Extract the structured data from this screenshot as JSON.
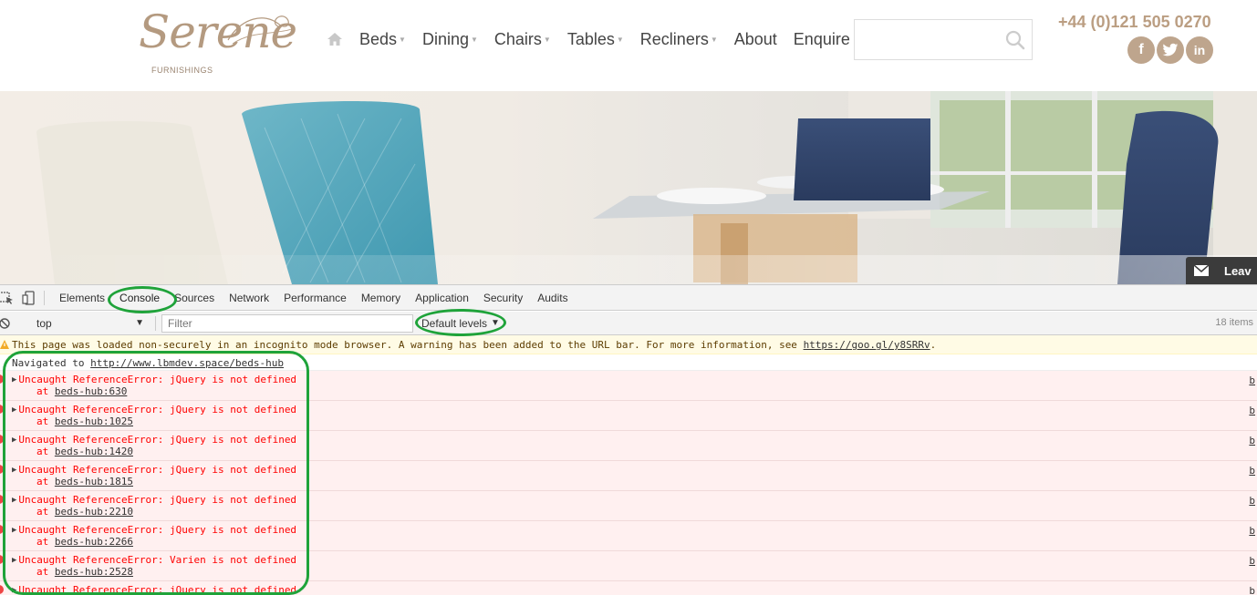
{
  "site": {
    "logo_text": "Serene",
    "logo_sub": "FURNISHINGS",
    "nav": [
      {
        "label": "Beds",
        "dropdown": true
      },
      {
        "label": "Dining",
        "dropdown": true
      },
      {
        "label": "Chairs",
        "dropdown": true
      },
      {
        "label": "Tables",
        "dropdown": true
      },
      {
        "label": "Recliners",
        "dropdown": true
      },
      {
        "label": "About",
        "dropdown": false
      },
      {
        "label": "Enquire",
        "dropdown": false
      }
    ],
    "search_placeholder": "",
    "phone": "+44 (0)121 505 0270",
    "socials": [
      "f",
      "t",
      "in"
    ],
    "feedback_label": "Leav"
  },
  "devtools": {
    "tabs": [
      "Elements",
      "Console",
      "Sources",
      "Network",
      "Performance",
      "Memory",
      "Application",
      "Security",
      "Audits"
    ],
    "active_tab": "Console",
    "context": "top",
    "filter_placeholder": "Filter",
    "levels": "Default levels",
    "items_count": "18 items",
    "warning": {
      "text": "This page was loaded non-securely in an incognito mode browser. A warning has been added to the URL bar. For more information, see ",
      "link": "https://goo.gl/y8SRRv",
      "suffix": "."
    },
    "navigated": {
      "prefix": "Navigated to ",
      "url": "http://www.lbmdev.space/beds-hub"
    },
    "errors": [
      {
        "message": "Uncaught ReferenceError: jQuery is not defined",
        "at": "beds-hub:630"
      },
      {
        "message": "Uncaught ReferenceError: jQuery is not defined",
        "at": "beds-hub:1025"
      },
      {
        "message": "Uncaught ReferenceError: jQuery is not defined",
        "at": "beds-hub:1420"
      },
      {
        "message": "Uncaught ReferenceError: jQuery is not defined",
        "at": "beds-hub:1815"
      },
      {
        "message": "Uncaught ReferenceError: jQuery is not defined",
        "at": "beds-hub:2210"
      },
      {
        "message": "Uncaught ReferenceError: jQuery is not defined",
        "at": "beds-hub:2266"
      },
      {
        "message": "Uncaught ReferenceError: Varien is not defined",
        "at": "beds-hub:2528"
      },
      {
        "message": "Uncaught ReferenceError: jQuery is not defined",
        "at": ""
      }
    ]
  },
  "colors": {
    "brand": "#bb9e82",
    "annotation": "#1fa33a",
    "error_text": "#ff0000",
    "error_bg": "#fff0f0",
    "warning_bg": "#fffbe5"
  }
}
